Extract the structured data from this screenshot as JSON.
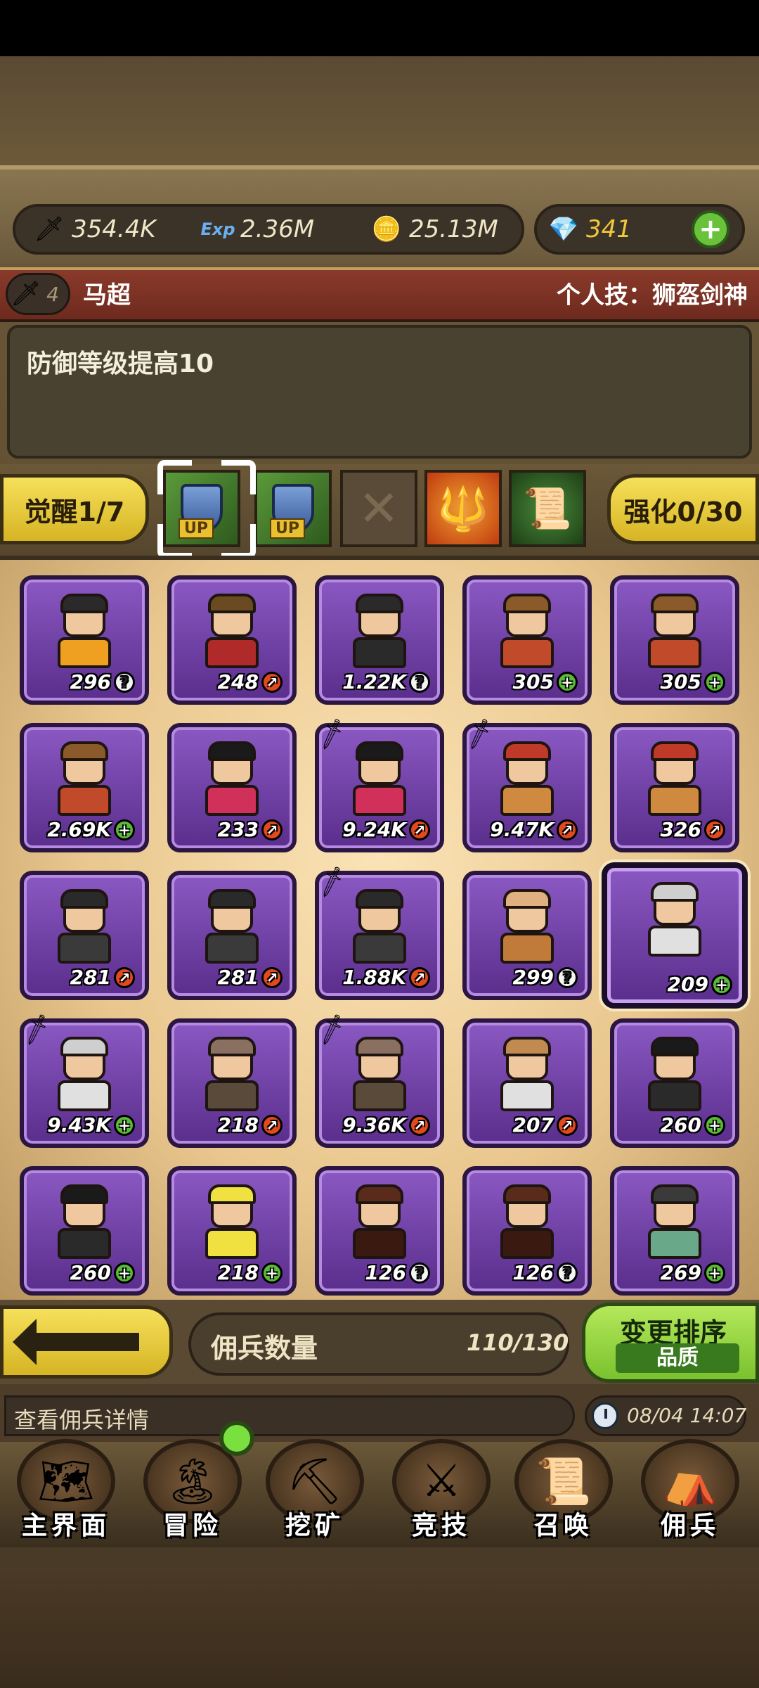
{
  "resources": {
    "attack": "354.4K",
    "exp_icon_label": "Exp",
    "exp": "2.36M",
    "gold": "25.13M",
    "gems": "341"
  },
  "hero": {
    "level": "4",
    "name": "马超",
    "skill": "个人技：狮盔剑神",
    "description": "防御等级提高10"
  },
  "awaken": {
    "label": "觉醒1/7"
  },
  "strengthen": {
    "label": "强化0/30"
  },
  "skill_slots": [
    {
      "up_label": "UP"
    },
    {
      "up_label": "UP"
    }
  ],
  "mercenaries": [
    {
      "value": "296",
      "badge": "?"
    },
    {
      "value": "248",
      "badge": "r"
    },
    {
      "value": "1.22K",
      "badge": "?"
    },
    {
      "value": "305",
      "badge": "+"
    },
    {
      "value": "305",
      "badge": "+"
    },
    {
      "value": "2.69K",
      "badge": "+"
    },
    {
      "value": "233",
      "badge": "r"
    },
    {
      "value": "9.24K",
      "badge": "r"
    },
    {
      "value": "9.47K",
      "badge": "r"
    },
    {
      "value": "326",
      "badge": "r"
    },
    {
      "value": "281",
      "badge": "r"
    },
    {
      "value": "281",
      "badge": "r"
    },
    {
      "value": "1.88K",
      "badge": "r"
    },
    {
      "value": "299",
      "badge": "?"
    },
    {
      "value": "209",
      "badge": "+"
    },
    {
      "value": "9.43K",
      "badge": "+"
    },
    {
      "value": "218",
      "badge": "r"
    },
    {
      "value": "9.36K",
      "badge": "r"
    },
    {
      "value": "207",
      "badge": "r"
    },
    {
      "value": "260",
      "badge": "+"
    },
    {
      "value": "260",
      "badge": "+"
    },
    {
      "value": "218",
      "badge": "+"
    },
    {
      "value": "126",
      "badge": "?"
    },
    {
      "value": "126",
      "badge": "?"
    },
    {
      "value": "269",
      "badge": "+"
    }
  ],
  "controls": {
    "count_label": "佣兵数量",
    "count_value": "110/130",
    "sort_label": "变更排序",
    "sort_mode": "品质"
  },
  "status": {
    "text": "查看佣兵详情",
    "time": "08/04 14:07"
  },
  "nav": [
    {
      "label": "主界面"
    },
    {
      "label": "冒险"
    },
    {
      "label": "挖矿"
    },
    {
      "label": "竞技"
    },
    {
      "label": "召唤"
    },
    {
      "label": "佣兵"
    }
  ],
  "colors": {
    "card_purple": "#7a48b2",
    "accent_yellow": "#f6e05a",
    "accent_green": "#7ac22e",
    "name_bar_red": "#8a3a2a"
  }
}
